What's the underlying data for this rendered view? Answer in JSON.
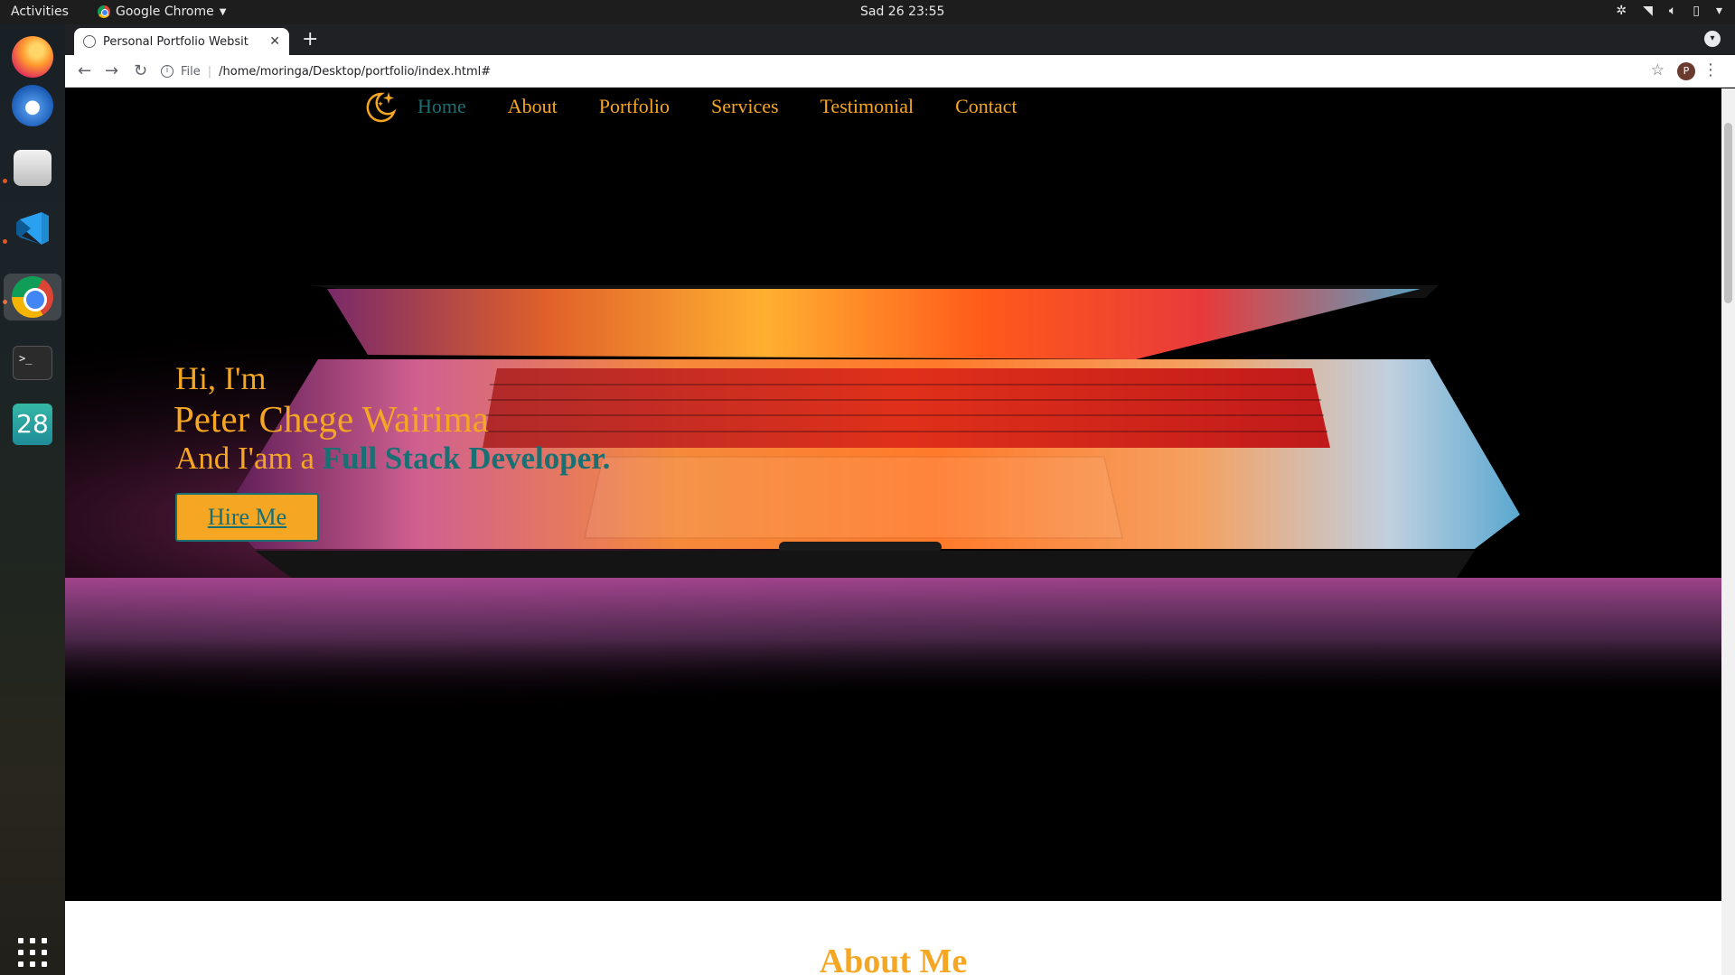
{
  "system_bar": {
    "activities": "Activities",
    "app_name": "Google Chrome",
    "clock": "Sad 26  23:55"
  },
  "dock": {
    "items": [
      "firefox-icon",
      "thunderbird-icon",
      "files-icon",
      "vscode-icon",
      "chrome-icon",
      "terminal-icon",
      "calendar-icon"
    ],
    "calendar_day": "28",
    "terminal_prompt": ">_"
  },
  "browser": {
    "tab_title": "Personal Portfolio Websit",
    "address_scheme": "File",
    "address_url": "/home/moringa/Desktop/portfolio/index.html#",
    "profile_initial": "P"
  },
  "site": {
    "nav": {
      "home": "Home",
      "about": "About",
      "portfolio": "Portfolio",
      "services": "Services",
      "testimonial": "Testimonial",
      "contact": "Contact"
    },
    "hero": {
      "greeting": "Hi, I'm",
      "name": "Peter Chege Wairima",
      "role_prefix": "And I'am a ",
      "role_highlight": "Full Stack Developer.",
      "cta": "Hire Me"
    },
    "about_title": "About Me"
  },
  "colors": {
    "accent": "#f5a623",
    "teal": "#1a6f73"
  }
}
